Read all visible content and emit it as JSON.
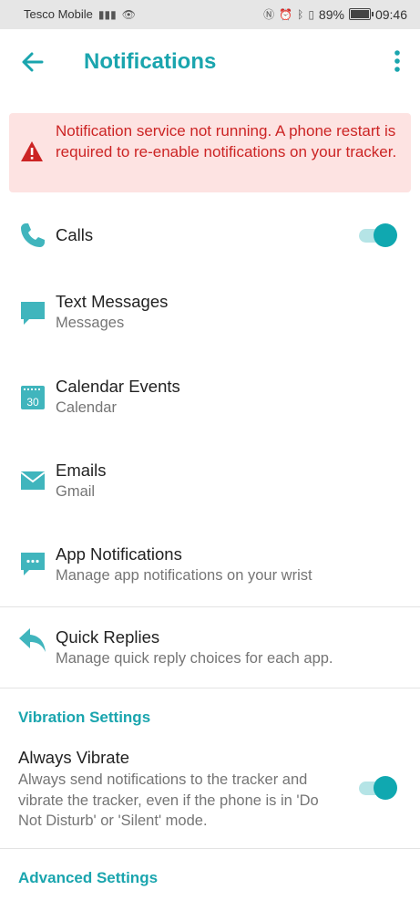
{
  "status_bar": {
    "carrier": "Tesco Mobile",
    "battery": "89%",
    "battery_level": 0.89,
    "time": "09:46"
  },
  "header": {
    "title": "Notifications"
  },
  "alert": {
    "message": "Notification service not running. A phone restart is required to re-enable notifications on your tracker."
  },
  "items": [
    {
      "title": "Calls",
      "subtitle": "",
      "icon": "phone-icon",
      "toggle_on": true
    },
    {
      "title": "Text Messages",
      "subtitle": "Messages",
      "icon": "chat-bubble-icon"
    },
    {
      "title": "Calendar Events",
      "subtitle": "Calendar",
      "icon": "calendar-icon",
      "icon_text": "30"
    },
    {
      "title": "Emails",
      "subtitle": "Gmail",
      "icon": "envelope-icon"
    },
    {
      "title": "App Notifications",
      "subtitle": "Manage app notifications on your wrist",
      "icon": "app-notification-icon"
    },
    {
      "title": "Quick Replies",
      "subtitle": "Manage quick reply choices for each app.",
      "icon": "reply-icon"
    }
  ],
  "vibration": {
    "section_title": "Vibration Settings",
    "title": "Always Vibrate",
    "description": "Always send notifications to the tracker and vibrate the tracker, even if the phone is in 'Do Not Disturb' or 'Silent' mode.",
    "toggle_on": true
  },
  "advanced": {
    "section_title": "Advanced Settings"
  },
  "colors": {
    "accent": "#1aa5ae",
    "toggle_thumb": "#10a8b0",
    "toggle_track": "#b5e4e6",
    "alert_bg": "#fde3e2",
    "alert_text": "#cc2424",
    "icon": "#40b5bd"
  }
}
